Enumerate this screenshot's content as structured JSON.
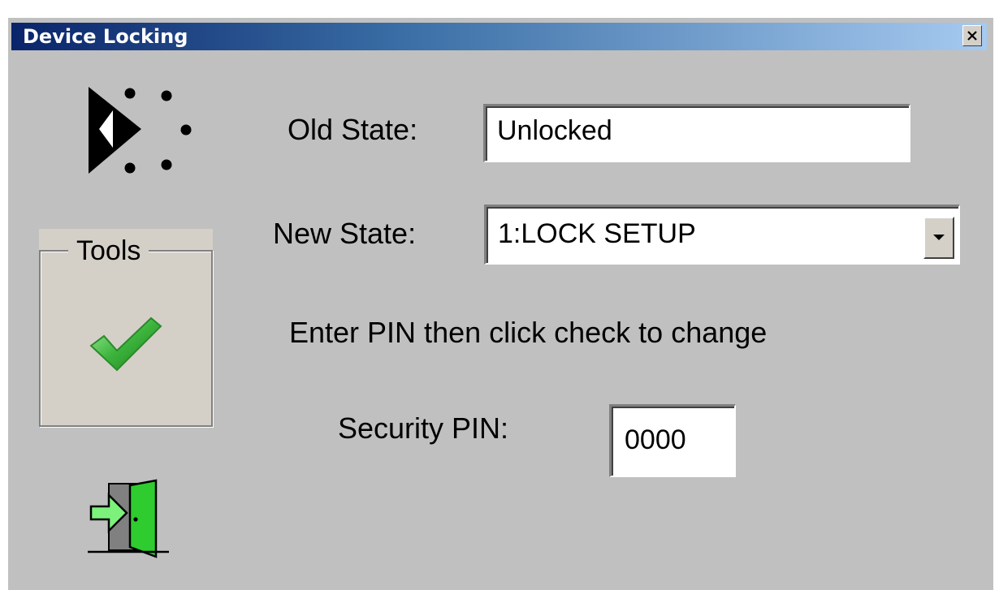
{
  "window": {
    "title": "Device Locking",
    "close_icon": "close-x-icon"
  },
  "logo": {
    "icon": "bk-logo-icon"
  },
  "form": {
    "old_state_label": "Old State:",
    "old_state_value": "Unlocked",
    "new_state_label": "New State:",
    "new_state_value": "1:LOCK SETUP",
    "instruction": "Enter PIN then click check to change",
    "pin_label": "Security PIN:",
    "pin_value": "0000"
  },
  "tools": {
    "legend": "Tools",
    "check_icon": "green-checkmark-icon"
  },
  "exit": {
    "icon": "exit-door-icon"
  },
  "colors": {
    "title_gradient_start": "#0a246a",
    "title_gradient_end": "#a6caf0",
    "window_bg": "#c0c0c0",
    "check_green": "#3cb43c",
    "door_green": "#2ecc2e"
  }
}
